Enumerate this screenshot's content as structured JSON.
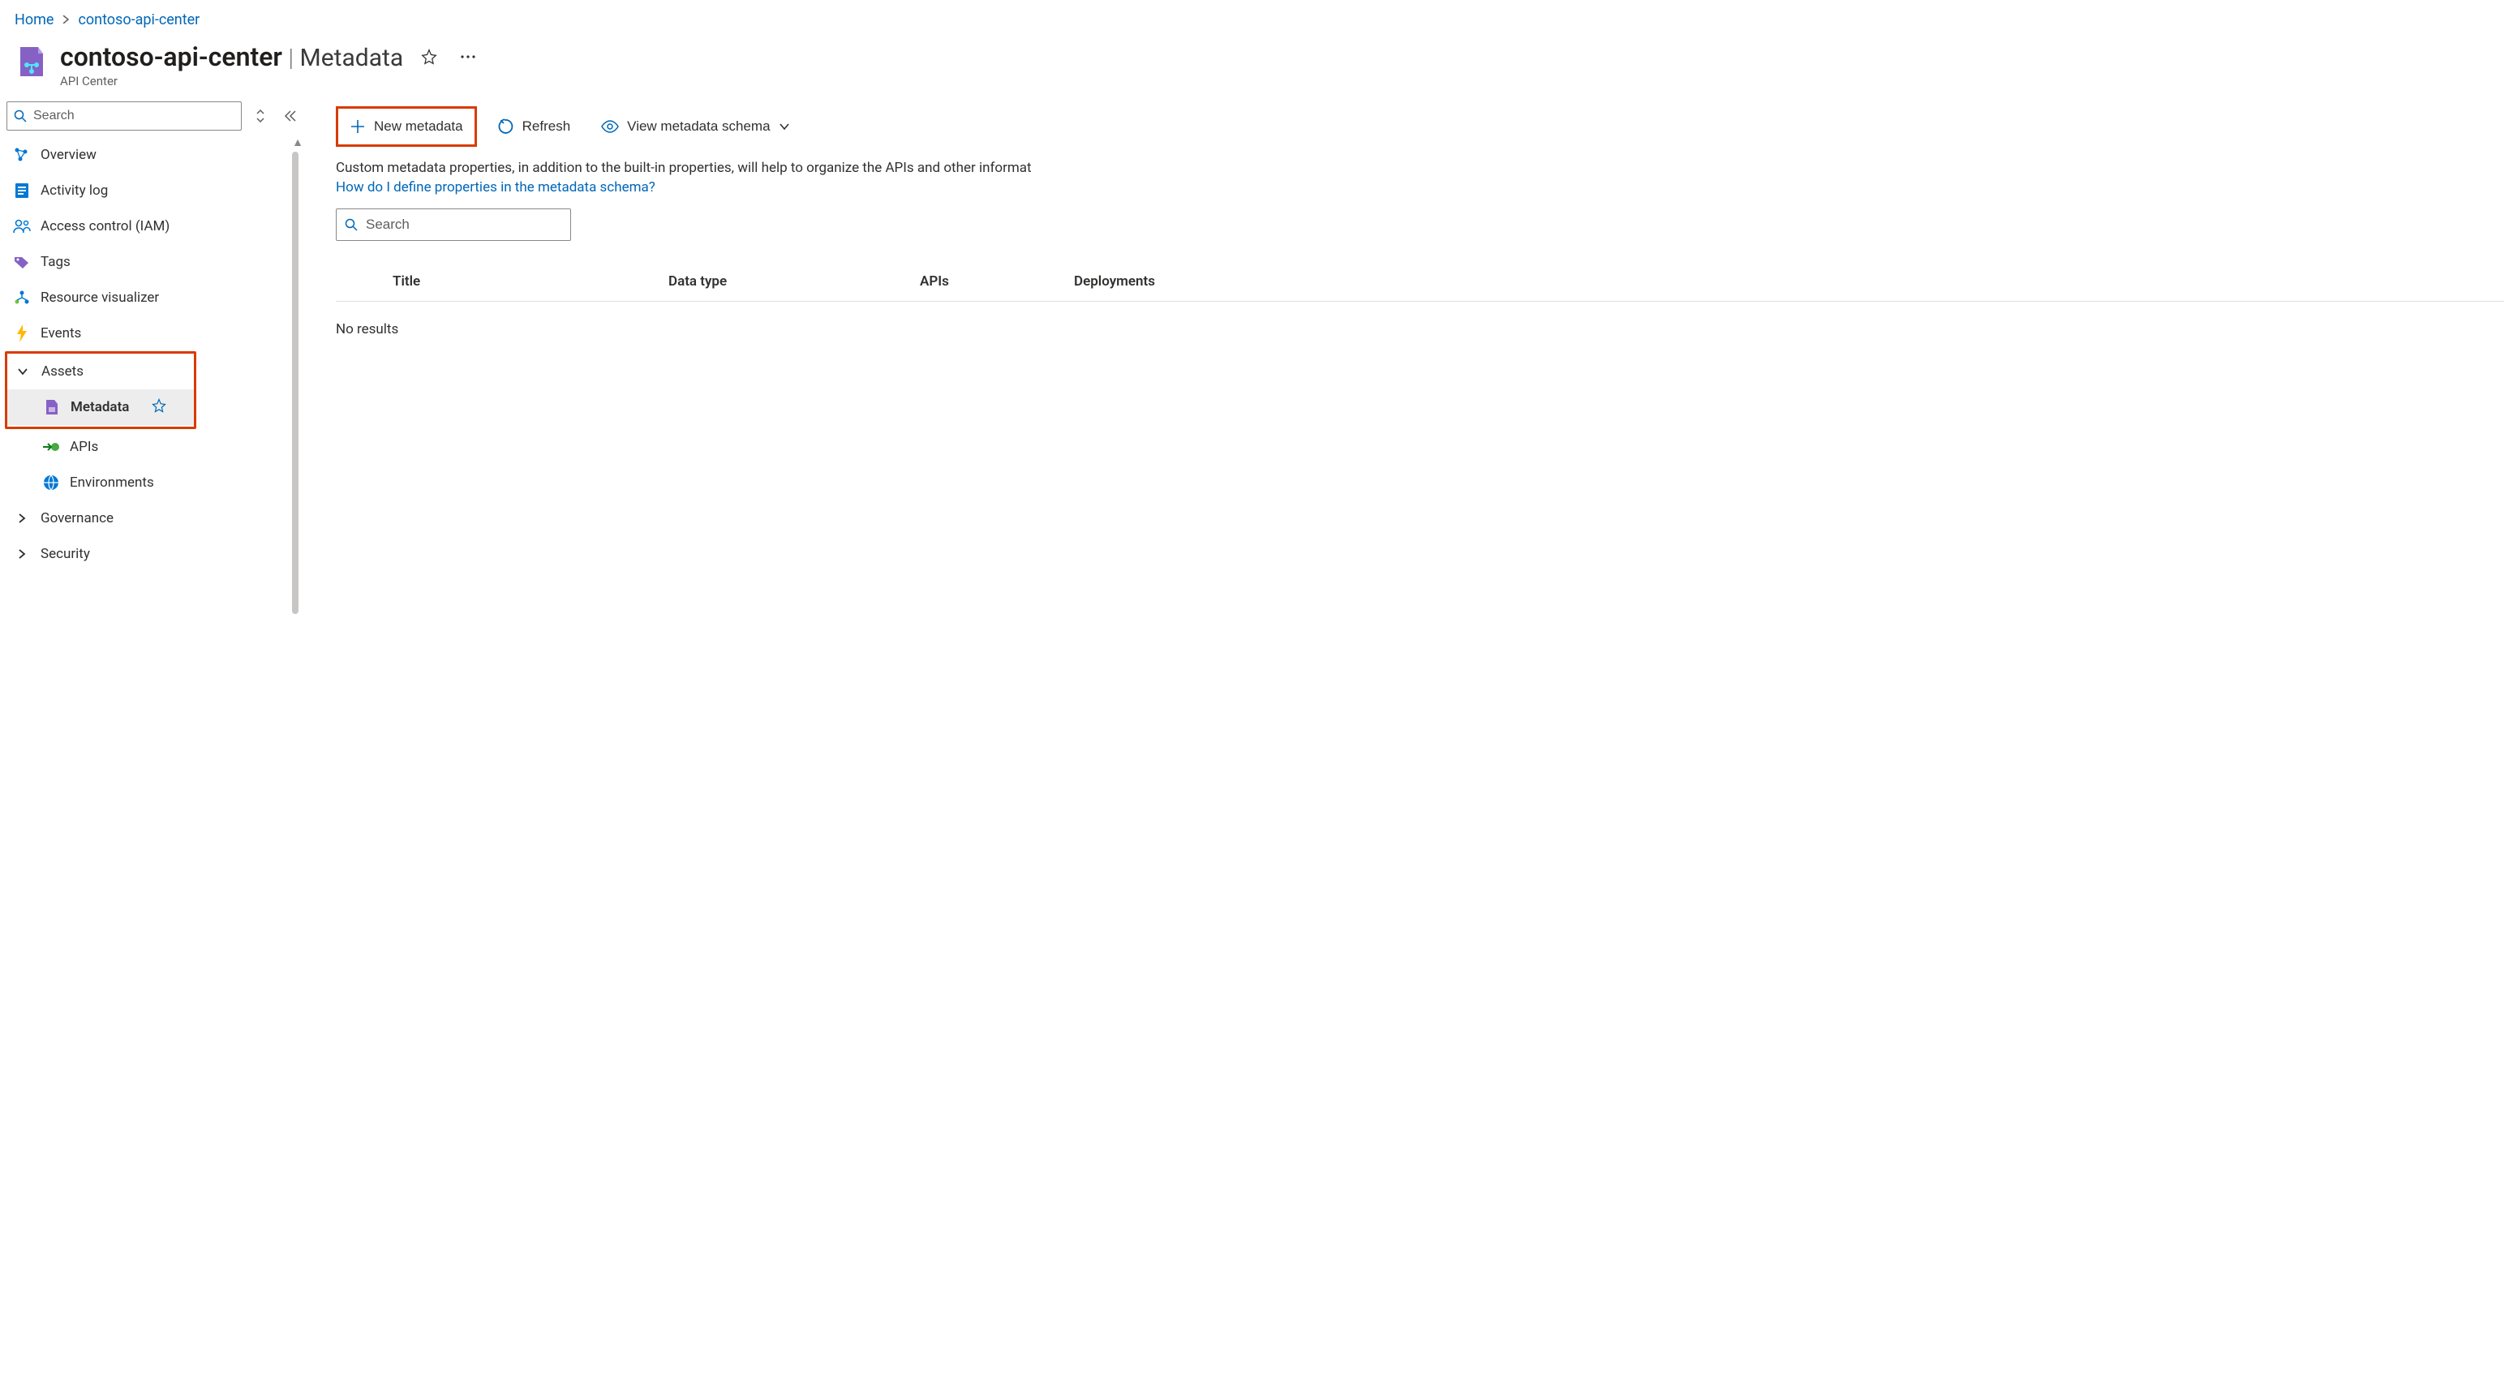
{
  "breadcrumb": {
    "home": "Home",
    "resource": "contoso-api-center"
  },
  "header": {
    "title": "contoso-api-center",
    "page_label": "Metadata",
    "subtitle": "API Center"
  },
  "sidebar": {
    "search_placeholder": "Search",
    "items": {
      "overview": "Overview",
      "activity": "Activity log",
      "iam": "Access control (IAM)",
      "tags": "Tags",
      "visualizer": "Resource visualizer",
      "events": "Events"
    },
    "assets": {
      "label": "Assets",
      "children": {
        "metadata": "Metadata",
        "apis": "APIs",
        "environments": "Environments"
      }
    },
    "governance": "Governance",
    "security": "Security"
  },
  "toolbar": {
    "new_metadata": "New metadata",
    "refresh": "Refresh",
    "view_schema": "View metadata schema"
  },
  "content": {
    "description": "Custom metadata properties, in addition to the built-in properties, will help to organize the APIs and other informat",
    "help_link": "How do I define properties in the metadata schema?",
    "search_placeholder": "Search",
    "columns": {
      "title": "Title",
      "data_type": "Data type",
      "apis": "APIs",
      "deployments": "Deployments"
    },
    "no_results": "No results"
  }
}
